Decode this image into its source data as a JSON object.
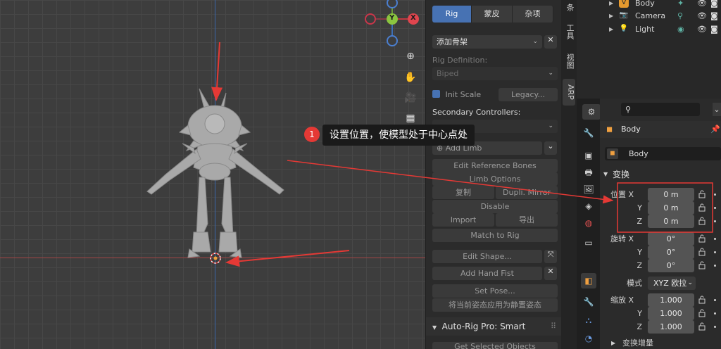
{
  "viewport": {
    "gizmo": {
      "y": "Y",
      "x": "X"
    },
    "annotation": {
      "number": "1",
      "text": "设置位置，使模型处于中心点处"
    }
  },
  "npanel": {
    "tabs": [
      "Rig",
      "蒙皮",
      "杂项"
    ],
    "add_armature": "添加骨架",
    "rig_definition_label": "Rig Definition:",
    "rig_definition_value": "Biped",
    "init_scale": "Init Scale",
    "legacy": "Legacy...",
    "secondary_controllers": "Secondary Controllers:",
    "add_limb": "Add Limb",
    "edit_reference_bones": "Edit Reference Bones",
    "limb_options": "Limb Options",
    "copy": "复制",
    "dupli_mirror": "Dupli. Mirror",
    "disable": "Disable",
    "import": "Import",
    "export": "导出",
    "match_to_rig": "Match to Rig",
    "edit_shape": "Edit Shape...",
    "add_hand_fist": "Add Hand Fist",
    "set_pose": "Set Pose...",
    "apply_rest_pose": "将当前姿态应用为静置姿态",
    "autorig_panel": "Auto-Rig Pro: Smart",
    "get_selected_objects": "Get Selected Objects"
  },
  "vertical_tabs": [
    "条目",
    "工具",
    "视图",
    "ARP"
  ],
  "outliner": {
    "items": [
      {
        "name": "Body",
        "icon": "armature-icon",
        "color": "#e69a2e"
      },
      {
        "name": "Camera",
        "icon": "camera-icon",
        "color": "#6f8fbf"
      },
      {
        "name": "Light",
        "icon": "light-icon",
        "color": "#d9a24a"
      }
    ]
  },
  "properties": {
    "object_name": "Body",
    "object_field": "Body",
    "transform_section": "变换",
    "location_label": "位置 X",
    "rotation_label": "旋转 X",
    "scale_label": "缩放 X",
    "y_label": "Y",
    "z_label": "Z",
    "location": [
      "0 m",
      "0 m",
      "0 m"
    ],
    "rotation": [
      "0°",
      "0°",
      "0°"
    ],
    "mode_label": "模式",
    "mode_value": "XYZ 欧拉",
    "scale": [
      "1.000",
      "1.000",
      "1.000"
    ],
    "delta_section": "变换增量"
  },
  "colors": {
    "accent": "#4772b3",
    "annotation": "#e53935"
  }
}
